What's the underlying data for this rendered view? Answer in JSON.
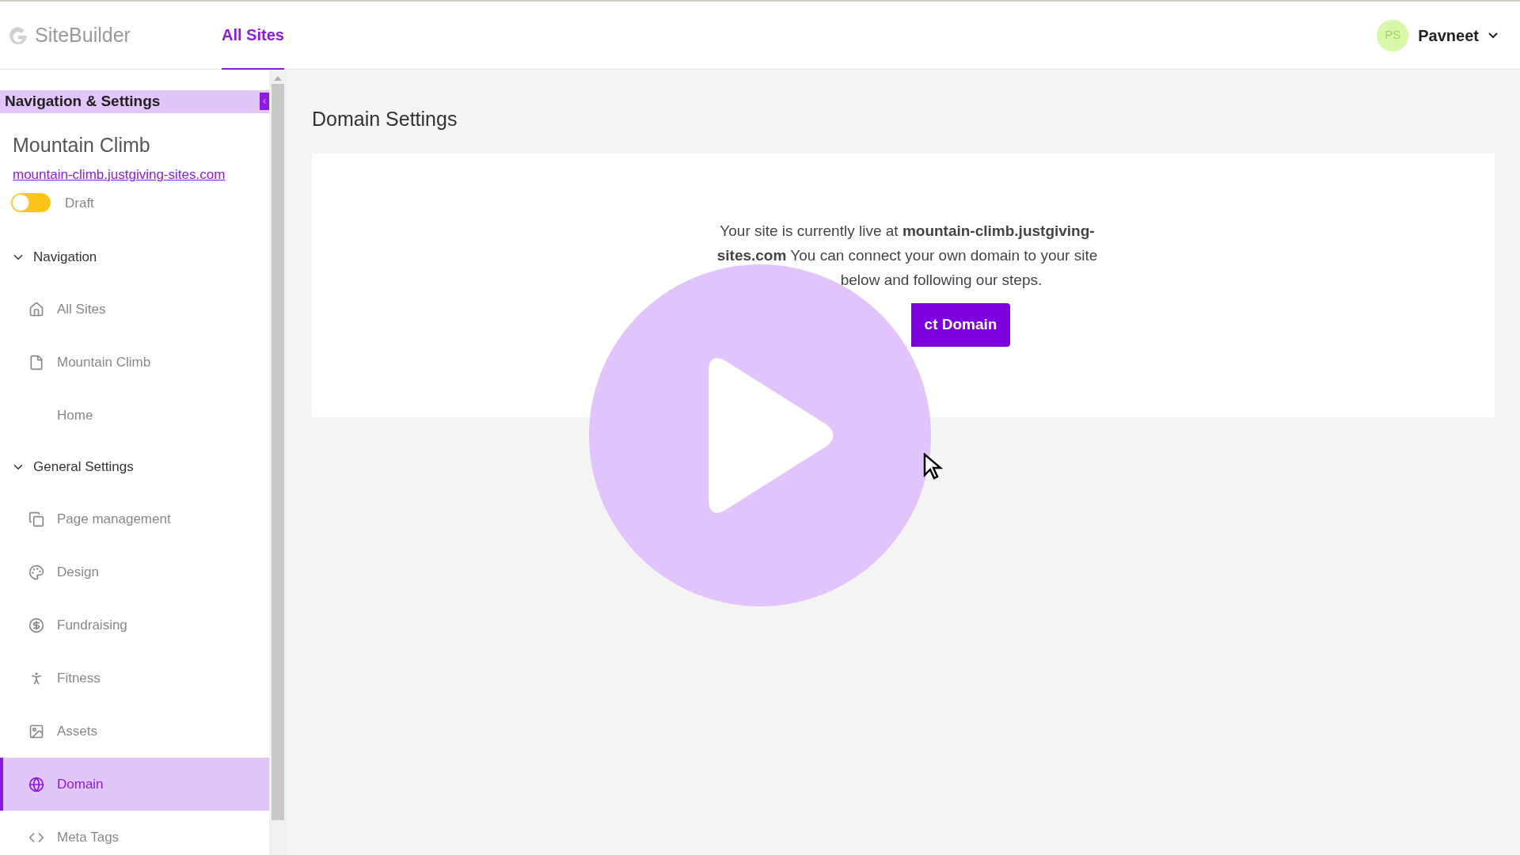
{
  "header": {
    "logo": "SiteBuilder",
    "tabs": [
      {
        "label": "All Sites",
        "selected": true
      }
    ],
    "user": {
      "initials": "PS",
      "name": "Pavneet"
    }
  },
  "sidebar": {
    "title": "Navigation & Settings",
    "site_name": "Mountain Climb",
    "site_url": "mountain-climb.justgiving-sites.com",
    "status_label": "Draft",
    "published": false,
    "sections": [
      {
        "label": "Navigation",
        "expanded": true,
        "items": [
          {
            "label": "All Sites",
            "selected": false
          },
          {
            "label": "Mountain Climb",
            "selected": false
          },
          {
            "label": "Home",
            "selected": false
          }
        ]
      },
      {
        "label": "General Settings",
        "expanded": true,
        "items": [
          {
            "label": "Page management",
            "selected": false
          },
          {
            "label": "Design",
            "selected": false
          },
          {
            "label": "Fundraising",
            "selected": false
          },
          {
            "label": "Fitness",
            "selected": false
          },
          {
            "label": "Assets",
            "selected": false
          },
          {
            "label": "Domain",
            "selected": true
          },
          {
            "label": "Meta Tags",
            "selected": false
          }
        ]
      }
    ]
  },
  "main": {
    "title": "Domain Settings",
    "message_lines": [
      "Your site is currently live at **mountain-climb.justgiving-**",
      "**sites.com** You can connect your own domain to your site",
      "below and following our steps."
    ],
    "button": "ct Domain"
  },
  "video": {
    "playing": false
  }
}
